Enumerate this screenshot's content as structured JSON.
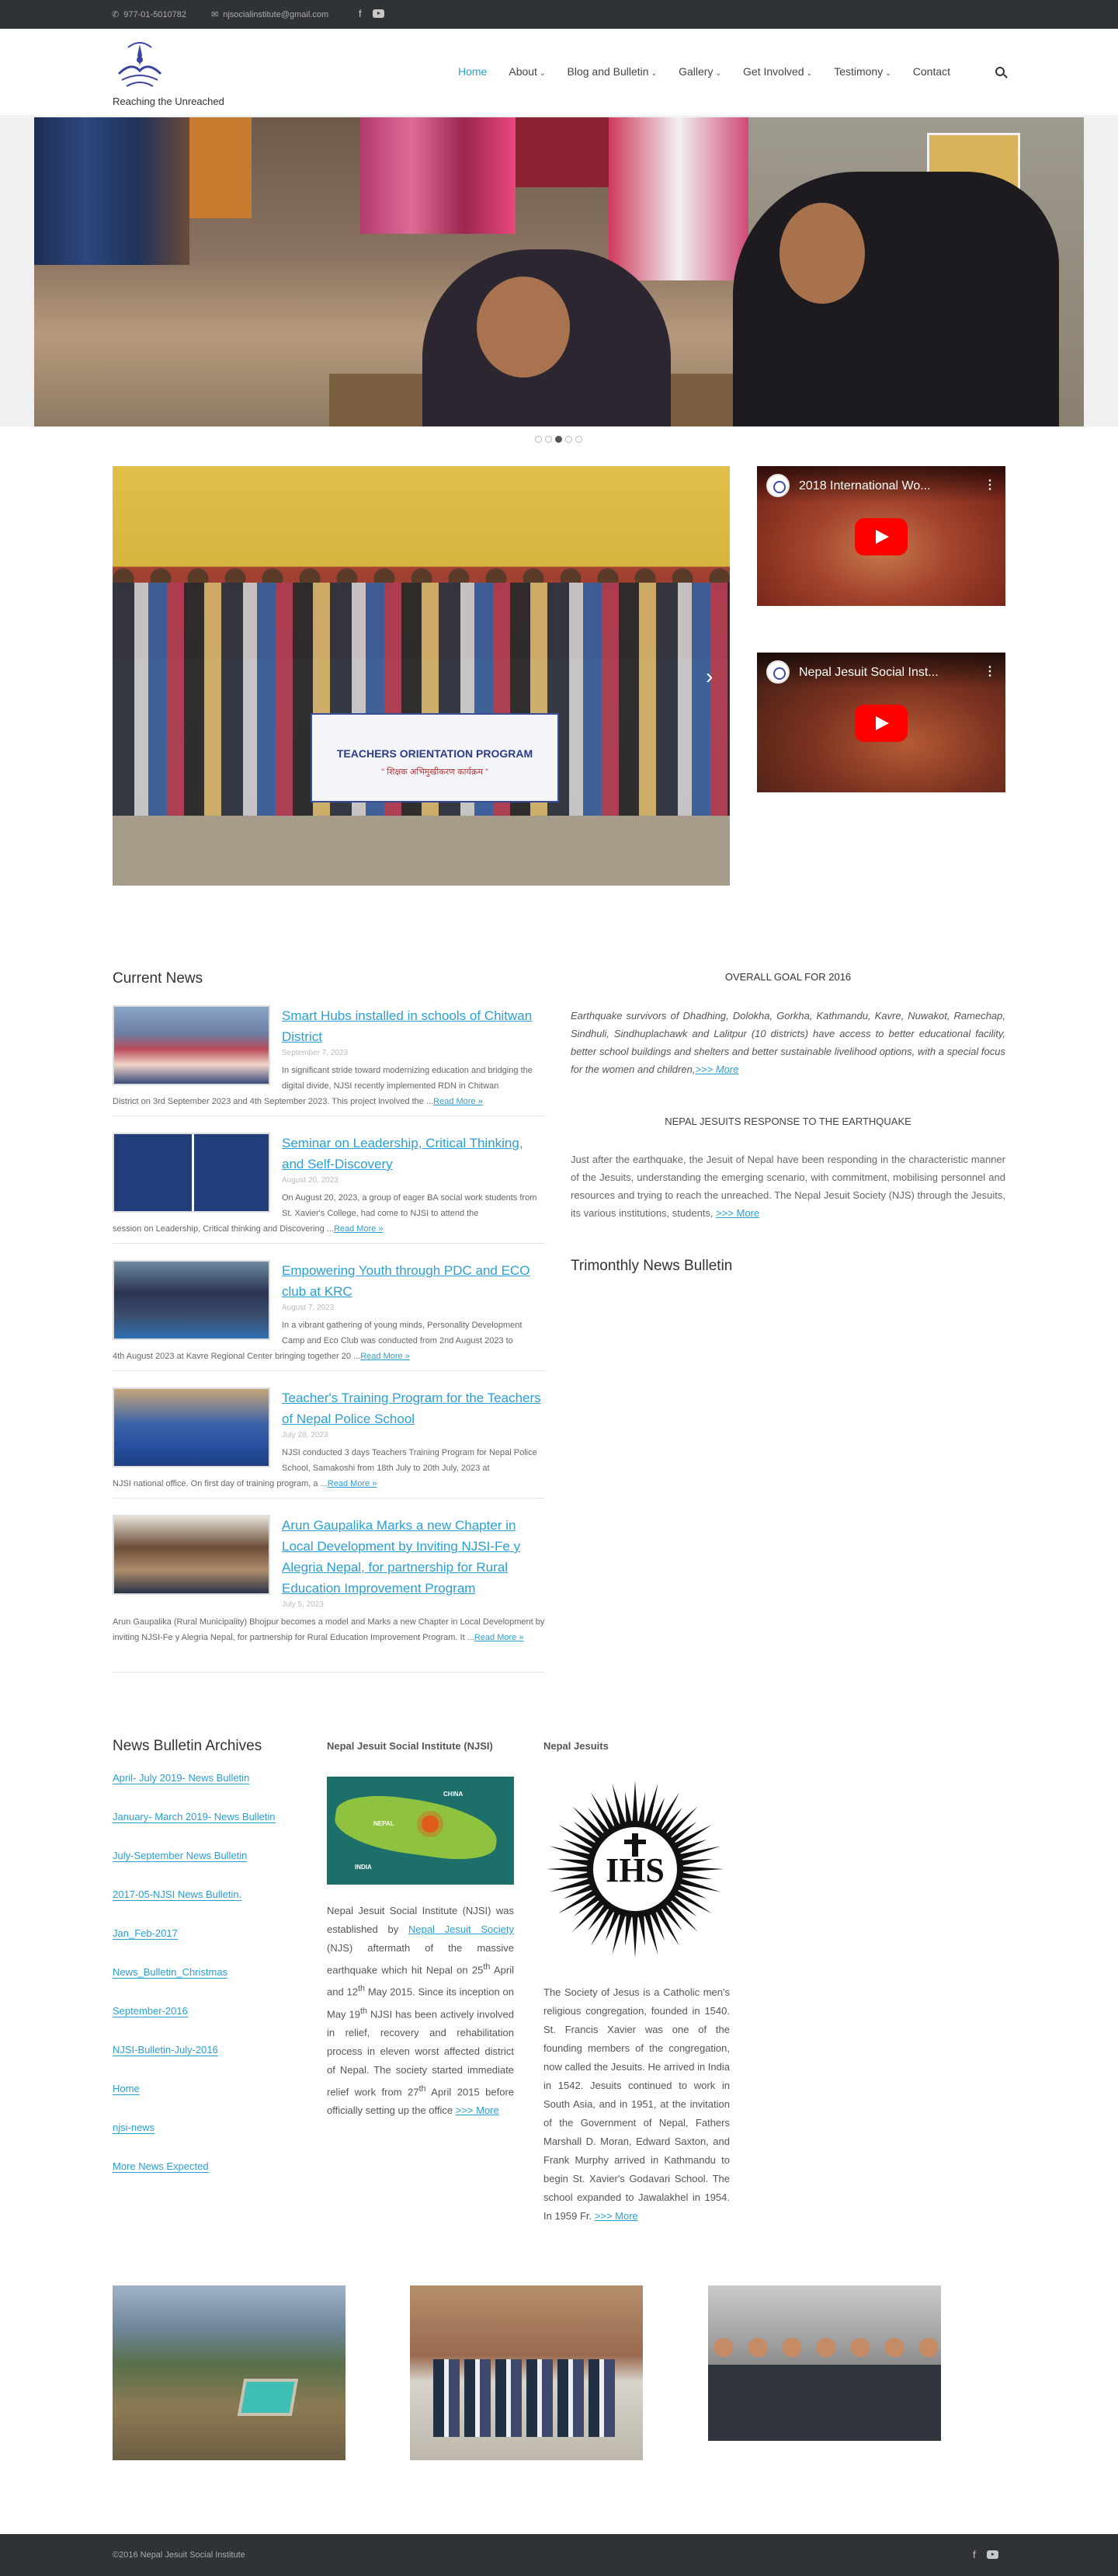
{
  "topbar": {
    "phone": "977-01-5010782",
    "email": "njsocialinstitute@gmail.com",
    "facebook_icon": "f"
  },
  "header": {
    "tagline": "Reaching the Unreached",
    "nav": [
      "Home",
      "About",
      "Blog and Bulletin",
      "Gallery",
      "Get Involved",
      "Testimony",
      "Contact"
    ],
    "nav_dropdown": [
      false,
      true,
      true,
      true,
      true,
      true,
      false
    ],
    "active_index": 0
  },
  "slider": {
    "dot_count": 5,
    "active_dot": 2
  },
  "group_photo": {
    "banner_title": "TEACHERS ORIENTATION PROGRAM",
    "banner_subtitle": "\" शिक्षक अभिमुखीकरण कार्यक्रम \""
  },
  "videos": [
    {
      "title": "2018 International Wo..."
    },
    {
      "title": "Nepal Jesuit Social Inst..."
    }
  ],
  "current_news": {
    "heading": "Current News",
    "read_more": "Read More »",
    "items": [
      {
        "title": "Smart Hubs installed in schools of Chitwan District",
        "date": "September 7, 2023",
        "lead": "In significant stride toward modernizing education and bridging the digital divide, NJSI recently implemented RDN in Chitwan",
        "rest": "District on 3rd September 2023 and 4th September 2023. This project involved the ..."
      },
      {
        "title": "Seminar on Leadership, Critical Thinking, and Self-Discovery",
        "date": "August 20, 2023",
        "lead": "On August 20, 2023, a group of eager BA social work students from St. Xavier's College, had come to NJSI to attend the",
        "rest": "session on Leadership, Critical thinking and Discovering ..."
      },
      {
        "title": "Empowering Youth through PDC and ECO club at KRC",
        "date": "August 7, 2023",
        "lead": "In a vibrant gathering of young minds, Personality Development Camp and Eco Club was conducted from 2nd August 2023 to",
        "rest": "4th August 2023 at Kavre Regional Center bringing together 20 ..."
      },
      {
        "title": "Teacher's Training Program for the Teachers of Nepal Police School",
        "date": "July 28, 2023",
        "lead": "NJSI conducted 3 days Teachers Training Program for Nepal Police School, Samakoshi from 18th July to 20th July, 2023 at",
        "rest": "NJSI national office. On first day of training program, a ..."
      },
      {
        "title": "Arun Gaupalika Marks a new Chapter in Local Development by Inviting NJSI-Fe y Alegria Nepal, for partnership for Rural Education Improvement Program",
        "date": "July 5, 2023",
        "lead": "",
        "rest": "Arun Gaupalika (Rural Municipality) Bhojpur becomes a model and Marks a new Chapter in Local Development by inviting NJSI-Fe y Alegria Nepal, for partnership for Rural Education Improvement Program. It ..."
      }
    ]
  },
  "goal": {
    "heading": "OVERALL GOAL FOR 2016",
    "text": "Earthquake survivors of  Dhadhing, Dolokha, Gorkha, Kathmandu, Kavre, Nuwakot, Ramechap, Sindhuli, Sindhuplachawk and Lalitpur (10 districts) have access to better educational facility, better school buildings and shelters and better sustainable livelihood options, with a special focus for the women and children,",
    "link": ">>> More"
  },
  "response": {
    "heading": "NEPAL JESUITS RESPONSE TO THE EARTHQUAKE",
    "text": "Just after the earthquake, the Jesuit of Nepal have been responding in the characteristic manner of the Jesuits, understanding the emerging scenario, with commitment, mobilising personnel and resources and trying to reach the unreached. The Nepal Jesuit Society (NJS) through the Jesuits, its various institutions, students,",
    "link": ">>> More"
  },
  "trimonthly": {
    "heading": "Trimonthly News Bulletin"
  },
  "archives": {
    "heading": "News Bulletin Archives",
    "links": [
      "April- July 2019- News Bulletin",
      "January- March 2019- News Bulletin",
      "July-September News Bulletin",
      "2017-05-NJSI News Bulletin.",
      "Jan_Feb-2017",
      "News_Bulletin_Christmas",
      "September-2016",
      "NJSI-Bulletin-July-2016",
      "Home",
      "njsi-news",
      "More News Expected"
    ]
  },
  "njsi": {
    "heading": "Nepal Jesuit Social Institute (NJSI)",
    "map_labels": {
      "nepal": "NEPAL",
      "china": "CHINA",
      "india": "INDIA"
    },
    "p1": "Nepal Jesuit Social Institute (NJSI) was established by",
    "society_link": "Nepal Jesuit Society",
    "p2": "(NJS) aftermath of the massive earthquake which hit Nepal on 25",
    "sup_th": "th",
    "p3": " April and 12",
    "p4": " May 2015. Since its inception on May 19",
    "p5": " NJSI has been actively involved in relief, recovery and rehabilitation process in eleven worst affected district of Nepal. The society started immediate relief work from 27",
    "p6": " April 2015 before officially setting up the office ",
    "link": ">>> More"
  },
  "jesuits": {
    "heading": "Nepal Jesuits",
    "ihs": "IHS",
    "text": "The Society of Jesus is a Catholic men's religious congregation, founded in 1540. St. Francis Xavier was one of the founding members of the congregation, now called the Jesuits. He arrived in India in 1542. Jesuits continued to work in South Asia, and in 1951, at the invitation of the Government of Nepal, Fathers Marshall D. Moran, Edward Saxton, and Frank Murphy arrived in Kathmandu to begin St. Xavier's Godavari School. The school expanded to Jawalakhel in 1954. In 1959 Fr. ",
    "link": ">>> More"
  },
  "footer": {
    "copyright": "©2016 Nepal Jesuit Social Institute",
    "facebook_icon": "f"
  },
  "colors": {
    "accent": "#2a9fd6",
    "bar": "#303336",
    "youtube": "#ff0000"
  }
}
